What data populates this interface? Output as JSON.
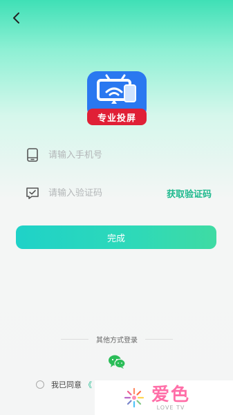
{
  "logo": {
    "ribbon_text": "专业投屏"
  },
  "form": {
    "phone_placeholder": "请输入手机号",
    "code_placeholder": "请输入验证码",
    "get_code_label": "获取验证码",
    "submit_label": "完成"
  },
  "other_login": {
    "label": "其他方式登录"
  },
  "agreement": {
    "text": "我已同意",
    "quote": "《"
  },
  "watermark": {
    "title": "爱色",
    "subtitle": "LOVE TV"
  },
  "colors": {
    "accent": "#1fb98e",
    "button": "#2ed9b8",
    "logo_blue": "#2a78f0",
    "logo_red": "#e02036",
    "wechat": "#2bbd58"
  }
}
